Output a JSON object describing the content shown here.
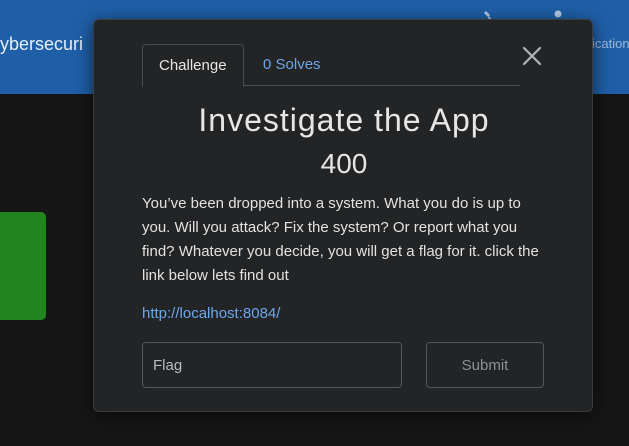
{
  "background": {
    "brand_text": "ybersecuri",
    "nav_right_text": "ication",
    "nav_icons": [
      "wrench-icon",
      "user-icon"
    ]
  },
  "modal": {
    "tabs": [
      {
        "label": "Challenge",
        "active": true
      },
      {
        "label": "0 Solves",
        "active": false
      }
    ],
    "close_symbol": "×",
    "title": "Investigate the App",
    "points": "400",
    "description": "You’ve been dropped into a system. What you do is up to you. Will you attack? Fix the system? Or report what you find? Whatever you decide, you will get a flag for it. click the link below lets find out",
    "link_text": "http://localhost:8084/",
    "flag_input": {
      "placeholder": "Flag",
      "value": ""
    },
    "submit_label": "Submit"
  },
  "colors": {
    "topbar": "#1f5fa8",
    "accent_link": "#6ea6e8",
    "green_card": "#21861f",
    "modal_bg": "#222426"
  }
}
